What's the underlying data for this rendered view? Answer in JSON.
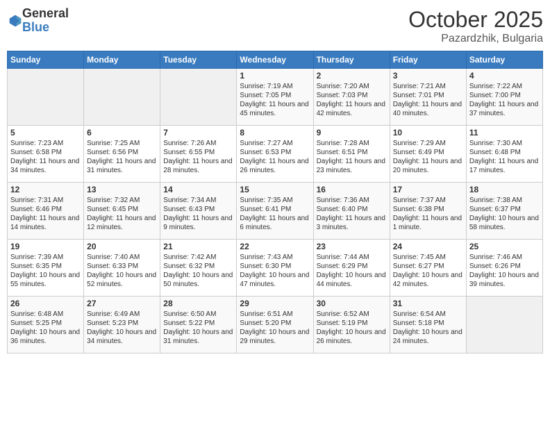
{
  "logo": {
    "general": "General",
    "blue": "Blue"
  },
  "title": "October 2025",
  "location": "Pazardzhik, Bulgaria",
  "weekdays": [
    "Sunday",
    "Monday",
    "Tuesday",
    "Wednesday",
    "Thursday",
    "Friday",
    "Saturday"
  ],
  "weeks": [
    [
      {
        "day": "",
        "info": ""
      },
      {
        "day": "",
        "info": ""
      },
      {
        "day": "",
        "info": ""
      },
      {
        "day": "1",
        "info": "Sunrise: 7:19 AM\nSunset: 7:05 PM\nDaylight: 11 hours and 45 minutes."
      },
      {
        "day": "2",
        "info": "Sunrise: 7:20 AM\nSunset: 7:03 PM\nDaylight: 11 hours and 42 minutes."
      },
      {
        "day": "3",
        "info": "Sunrise: 7:21 AM\nSunset: 7:01 PM\nDaylight: 11 hours and 40 minutes."
      },
      {
        "day": "4",
        "info": "Sunrise: 7:22 AM\nSunset: 7:00 PM\nDaylight: 11 hours and 37 minutes."
      }
    ],
    [
      {
        "day": "5",
        "info": "Sunrise: 7:23 AM\nSunset: 6:58 PM\nDaylight: 11 hours and 34 minutes."
      },
      {
        "day": "6",
        "info": "Sunrise: 7:25 AM\nSunset: 6:56 PM\nDaylight: 11 hours and 31 minutes."
      },
      {
        "day": "7",
        "info": "Sunrise: 7:26 AM\nSunset: 6:55 PM\nDaylight: 11 hours and 28 minutes."
      },
      {
        "day": "8",
        "info": "Sunrise: 7:27 AM\nSunset: 6:53 PM\nDaylight: 11 hours and 26 minutes."
      },
      {
        "day": "9",
        "info": "Sunrise: 7:28 AM\nSunset: 6:51 PM\nDaylight: 11 hours and 23 minutes."
      },
      {
        "day": "10",
        "info": "Sunrise: 7:29 AM\nSunset: 6:49 PM\nDaylight: 11 hours and 20 minutes."
      },
      {
        "day": "11",
        "info": "Sunrise: 7:30 AM\nSunset: 6:48 PM\nDaylight: 11 hours and 17 minutes."
      }
    ],
    [
      {
        "day": "12",
        "info": "Sunrise: 7:31 AM\nSunset: 6:46 PM\nDaylight: 11 hours and 14 minutes."
      },
      {
        "day": "13",
        "info": "Sunrise: 7:32 AM\nSunset: 6:45 PM\nDaylight: 11 hours and 12 minutes."
      },
      {
        "day": "14",
        "info": "Sunrise: 7:34 AM\nSunset: 6:43 PM\nDaylight: 11 hours and 9 minutes."
      },
      {
        "day": "15",
        "info": "Sunrise: 7:35 AM\nSunset: 6:41 PM\nDaylight: 11 hours and 6 minutes."
      },
      {
        "day": "16",
        "info": "Sunrise: 7:36 AM\nSunset: 6:40 PM\nDaylight: 11 hours and 3 minutes."
      },
      {
        "day": "17",
        "info": "Sunrise: 7:37 AM\nSunset: 6:38 PM\nDaylight: 11 hours and 1 minute."
      },
      {
        "day": "18",
        "info": "Sunrise: 7:38 AM\nSunset: 6:37 PM\nDaylight: 10 hours and 58 minutes."
      }
    ],
    [
      {
        "day": "19",
        "info": "Sunrise: 7:39 AM\nSunset: 6:35 PM\nDaylight: 10 hours and 55 minutes."
      },
      {
        "day": "20",
        "info": "Sunrise: 7:40 AM\nSunset: 6:33 PM\nDaylight: 10 hours and 52 minutes."
      },
      {
        "day": "21",
        "info": "Sunrise: 7:42 AM\nSunset: 6:32 PM\nDaylight: 10 hours and 50 minutes."
      },
      {
        "day": "22",
        "info": "Sunrise: 7:43 AM\nSunset: 6:30 PM\nDaylight: 10 hours and 47 minutes."
      },
      {
        "day": "23",
        "info": "Sunrise: 7:44 AM\nSunset: 6:29 PM\nDaylight: 10 hours and 44 minutes."
      },
      {
        "day": "24",
        "info": "Sunrise: 7:45 AM\nSunset: 6:27 PM\nDaylight: 10 hours and 42 minutes."
      },
      {
        "day": "25",
        "info": "Sunrise: 7:46 AM\nSunset: 6:26 PM\nDaylight: 10 hours and 39 minutes."
      }
    ],
    [
      {
        "day": "26",
        "info": "Sunrise: 6:48 AM\nSunset: 5:25 PM\nDaylight: 10 hours and 36 minutes."
      },
      {
        "day": "27",
        "info": "Sunrise: 6:49 AM\nSunset: 5:23 PM\nDaylight: 10 hours and 34 minutes."
      },
      {
        "day": "28",
        "info": "Sunrise: 6:50 AM\nSunset: 5:22 PM\nDaylight: 10 hours and 31 minutes."
      },
      {
        "day": "29",
        "info": "Sunrise: 6:51 AM\nSunset: 5:20 PM\nDaylight: 10 hours and 29 minutes."
      },
      {
        "day": "30",
        "info": "Sunrise: 6:52 AM\nSunset: 5:19 PM\nDaylight: 10 hours and 26 minutes."
      },
      {
        "day": "31",
        "info": "Sunrise: 6:54 AM\nSunset: 5:18 PM\nDaylight: 10 hours and 24 minutes."
      },
      {
        "day": "",
        "info": ""
      }
    ]
  ]
}
